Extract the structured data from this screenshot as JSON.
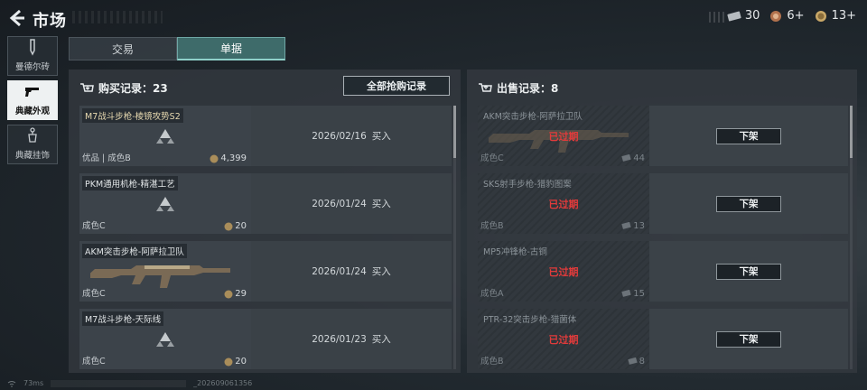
{
  "header": {
    "title": "市场",
    "currencies": [
      {
        "icon": "ticket-icon",
        "value": "30"
      },
      {
        "icon": "token-icon",
        "value": "6+"
      },
      {
        "icon": "coin-icon",
        "value": "13+"
      }
    ]
  },
  "nav": [
    {
      "label": "曼德尔砖",
      "icon": "brick-icon",
      "active": false
    },
    {
      "label": "典藏外观",
      "icon": "pistol-icon",
      "active": true
    },
    {
      "label": "典藏挂饰",
      "icon": "charm-icon",
      "active": false
    }
  ],
  "tabs": [
    {
      "label": "交易"
    },
    {
      "label": "单据"
    }
  ],
  "buy": {
    "title": "购买记录：23",
    "all_button": "全部抢购记录",
    "rows": [
      {
        "name": "M7战斗步枪-棱镜攻势S2",
        "quality": "优品 | 成色B",
        "price": "4,399",
        "date": "2026/02/16",
        "action": "买入",
        "gold": true,
        "gun": false
      },
      {
        "name": "PKM通用机枪-精湛工艺",
        "quality": "成色C",
        "price": "20",
        "date": "2026/01/24",
        "action": "买入",
        "gold": false,
        "gun": false
      },
      {
        "name": "AKM突击步枪-阿萨拉卫队",
        "quality": "成色C",
        "price": "29",
        "date": "2026/01/24",
        "action": "买入",
        "gold": false,
        "gun": true
      },
      {
        "name": "M7战斗步枪-天际线",
        "quality": "成色C",
        "price": "20",
        "date": "2026/01/23",
        "action": "买入",
        "gold": false,
        "gun": false
      }
    ]
  },
  "sell": {
    "title": "出售记录：8",
    "rows": [
      {
        "name": "AKM突击步枪-阿萨拉卫队",
        "quality": "成色C",
        "price": "44",
        "status": "已过期",
        "button": "下架",
        "gun": true
      },
      {
        "name": "SKS射手步枪-猎豹图案",
        "quality": "成色B",
        "price": "13",
        "status": "已过期",
        "button": "下架",
        "gun": false
      },
      {
        "name": "MP5冲锋枪-古铜",
        "quality": "成色A",
        "price": "15",
        "status": "已过期",
        "button": "下架",
        "gun": false
      },
      {
        "name": "PTR-32突击步枪-猎菌体",
        "quality": "成色B",
        "price": "8",
        "status": "已过期",
        "button": "下架",
        "gun": false
      }
    ]
  },
  "footer": {
    "ping": "73ms",
    "id": "_202609061356"
  }
}
